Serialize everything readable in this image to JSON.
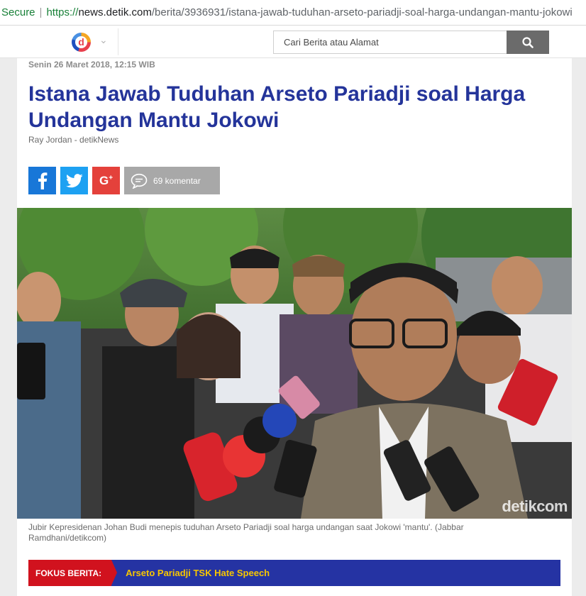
{
  "browser": {
    "secure_label": "Secure",
    "url_scheme": "https://",
    "url_host": "news.detik.com",
    "url_path": "/berita/3936931/istana-jawab-tuduhan-arseto-pariadji-soal-harga-undangan-mantu-jokowi"
  },
  "header": {
    "logo_letter": "d",
    "search_placeholder": "Cari Berita atau Alamat"
  },
  "article": {
    "date": "Senin 26 Maret 2018, 12:15 WIB",
    "title": "Istana Jawab Tuduhan Arseto Pariadji soal Harga Undangan Mantu Jokowi",
    "author": "Ray Jordan - detikNews",
    "share": {
      "comment_count": "69 komentar"
    },
    "photo": {
      "watermark": "detikcom"
    },
    "caption": "Jubir Kepresidenan Johan Budi menepis tuduhan Arseto Pariadji soal harga undangan saat Jokowi 'mantu'. (Jabbar Ramdhani/detikcom)"
  },
  "fokus": {
    "label": "FOKUS BERITA:",
    "link": "Arseto Pariadji TSK Hate Speech"
  },
  "colors": {
    "title": "#24349a",
    "facebook": "#1877d8",
    "twitter": "#1da1f2",
    "google_plus": "#e4413b",
    "fokus_bar": "#2533a3",
    "fokus_label": "#d1121e",
    "fokus_link": "#f7c600"
  }
}
